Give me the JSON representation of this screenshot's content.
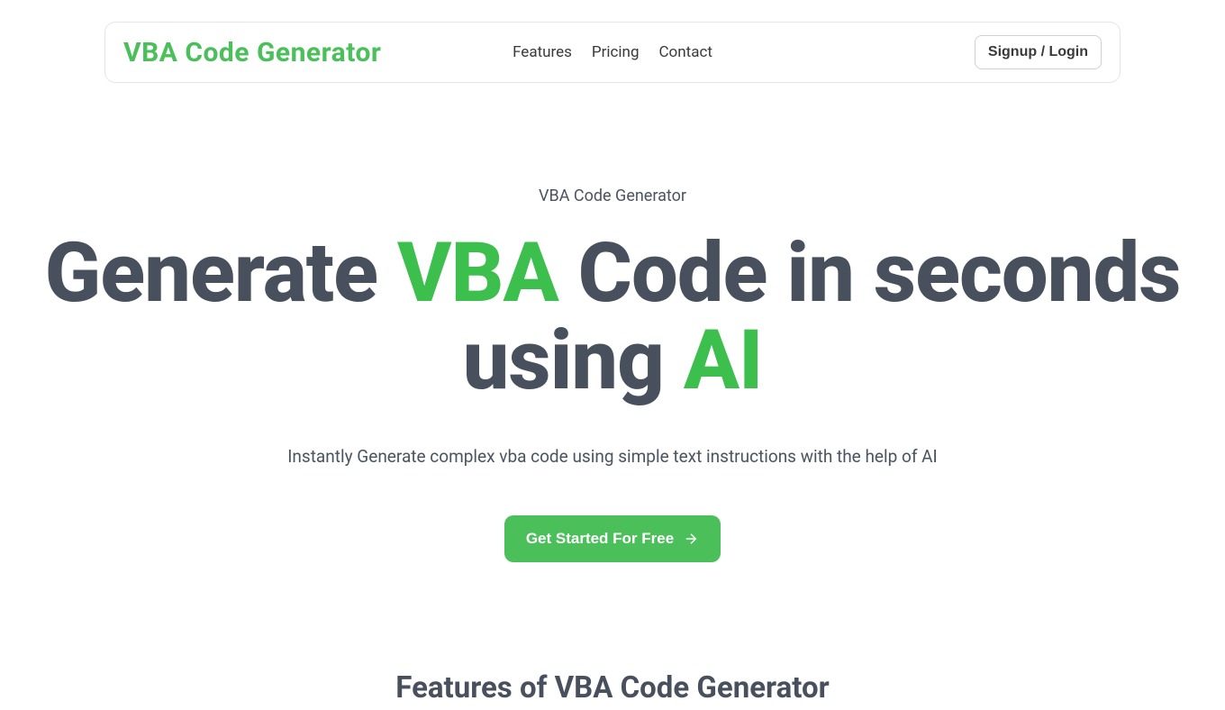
{
  "header": {
    "logo": "VBA Code Generator",
    "nav": {
      "features": "Features",
      "pricing": "Pricing",
      "contact": "Contact"
    },
    "signup": "Signup / Login"
  },
  "hero": {
    "label": "VBA Code Generator",
    "title_part1": "Generate ",
    "title_highlight1": "VBA",
    "title_part2": " Code in seconds using ",
    "title_highlight2": "AI",
    "subtitle": "Instantly Generate complex vba code using simple text instructions with the help of AI",
    "cta": "Get Started For Free"
  },
  "features": {
    "heading": "Features of VBA Code Generator"
  }
}
